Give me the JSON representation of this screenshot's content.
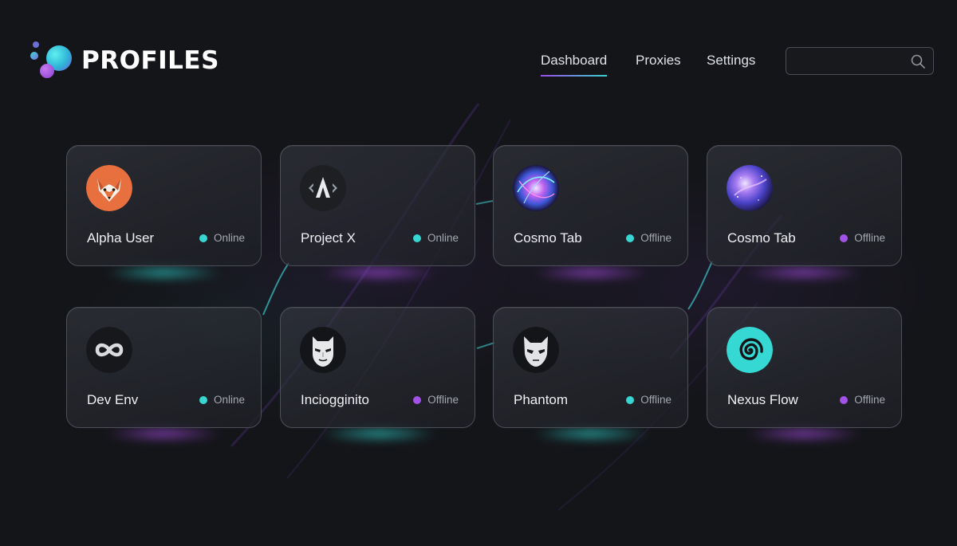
{
  "app": {
    "title": "PROFILES",
    "logo_icon": "bubbles-logo-icon"
  },
  "nav": {
    "items": [
      {
        "label": "Dashboard",
        "active": true
      },
      {
        "label": "Proxies",
        "active": false
      },
      {
        "label": "Settings",
        "active": false
      }
    ]
  },
  "search": {
    "value": "",
    "placeholder": "",
    "icon": "search-icon"
  },
  "colors": {
    "online": "#38d6d2",
    "offline_teal": "#38d6d2",
    "offline_purple": "#a252e6",
    "accent_teal": "#38d3cf",
    "accent_purple": "#9a4de8"
  },
  "profiles": [
    {
      "name": "Alpha User",
      "status": "Online",
      "dot_color": "#38d6d2",
      "icon": "fox-icon",
      "glow": "teal"
    },
    {
      "name": "Project X",
      "status": "Online",
      "dot_color": "#38d6d2",
      "icon": "letter-a-logo-icon",
      "glow": "purple"
    },
    {
      "name": "Cosmo Tab",
      "status": "Offline",
      "dot_color": "#38d6d2",
      "icon": "energy-orb-icon",
      "glow": "purple"
    },
    {
      "name": "Cosmo Tab",
      "status": "Offline",
      "dot_color": "#a252e6",
      "icon": "galaxy-icon",
      "glow": "purple"
    },
    {
      "name": "Dev Env",
      "status": "Online",
      "dot_color": "#38d6d2",
      "icon": "infinity-icon",
      "glow": "purple"
    },
    {
      "name": "Inciogginito",
      "status": "Offline",
      "dot_color": "#a252e6",
      "icon": "mask-icon",
      "glow": "teal"
    },
    {
      "name": "Phantom",
      "status": "Offline",
      "dot_color": "#38d6d2",
      "icon": "phantom-mask-icon",
      "glow": "teal"
    },
    {
      "name": "Nexus Flow",
      "status": "Offline",
      "dot_color": "#a252e6",
      "icon": "spiral-icon",
      "glow": "purple"
    }
  ]
}
